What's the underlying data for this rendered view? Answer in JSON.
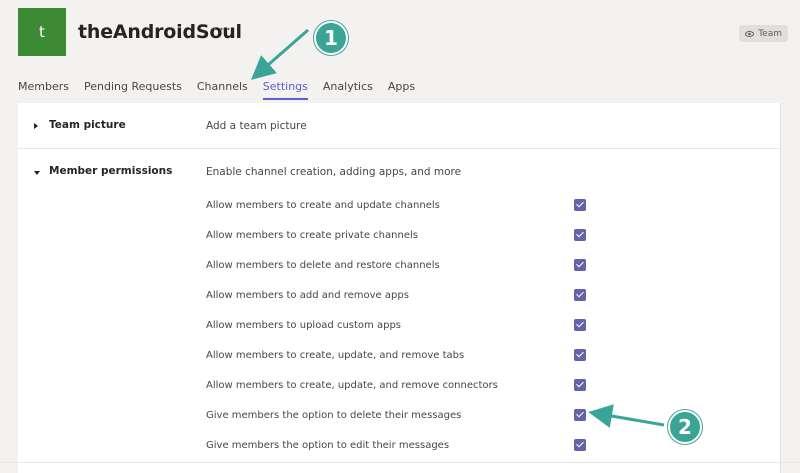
{
  "header": {
    "avatar_letter": "t",
    "team_name": "theAndroidSoul",
    "more_label": "···",
    "badge_label": "Team"
  },
  "tabs": [
    {
      "label": "Members"
    },
    {
      "label": "Pending Requests"
    },
    {
      "label": "Channels"
    },
    {
      "label": "Settings",
      "active": true
    },
    {
      "label": "Analytics"
    },
    {
      "label": "Apps"
    }
  ],
  "sections": {
    "team_picture": {
      "title": "Team picture",
      "description": "Add a team picture"
    },
    "member_permissions": {
      "title": "Member permissions",
      "description": "Enable channel creation, adding apps, and more",
      "permissions": [
        {
          "label": "Allow members to create and update channels",
          "checked": true
        },
        {
          "label": "Allow members to create private channels",
          "checked": true
        },
        {
          "label": "Allow members to delete and restore channels",
          "checked": true
        },
        {
          "label": "Allow members to add and remove apps",
          "checked": true
        },
        {
          "label": "Allow members to upload custom apps",
          "checked": true
        },
        {
          "label": "Allow members to create, update, and remove tabs",
          "checked": true
        },
        {
          "label": "Allow members to create, update, and remove connectors",
          "checked": true
        },
        {
          "label": "Give members the option to delete their messages",
          "checked": true
        },
        {
          "label": "Give members the option to edit their messages",
          "checked": true
        }
      ]
    }
  },
  "callouts": [
    {
      "number": "1"
    },
    {
      "number": "2"
    }
  ],
  "colors": {
    "accent": "#5b5fc7",
    "checkbox": "#6264a7",
    "avatar": "#3d8b37",
    "callout": "#3aa597"
  },
  "icons": {
    "badge": "eye-icon",
    "collapsed": "caret-right-icon",
    "expanded": "caret-down-icon",
    "checked": "checkmark-icon"
  }
}
